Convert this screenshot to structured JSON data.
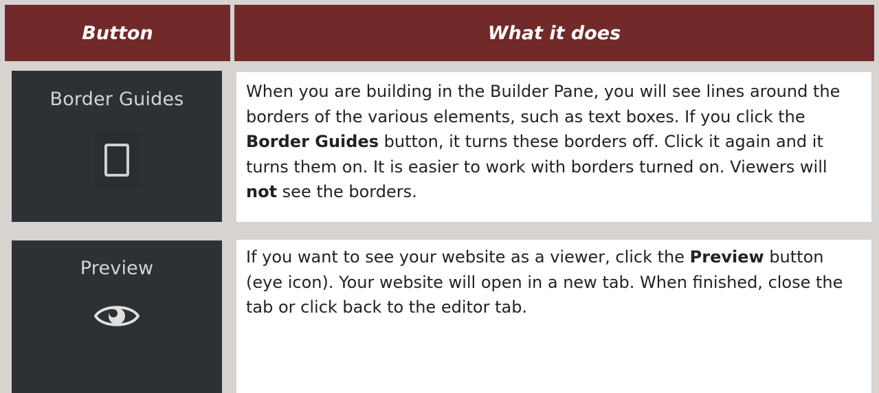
{
  "header": {
    "col_button": "Button",
    "col_what": "What it does"
  },
  "rows": [
    {
      "button_label": "Border Guides",
      "icon": "square-outline-icon",
      "desc_parts": [
        "When you are building in the Builder Pane, you will see lines around the borders of the various elements, such as text boxes. If you click the ",
        "Border Guides",
        " button, it turns these borders off. Click it again and it turns them on. It is easier to work with borders turned on. Viewers will ",
        "not",
        " see the borders."
      ]
    },
    {
      "button_label": "Preview",
      "icon": "eye-icon",
      "desc_parts": [
        "If you want to see your website as a viewer, click the ",
        "Preview",
        " button (eye icon). Your website will open in a new tab. When finished, close the tab or click back to the editor tab."
      ]
    }
  ],
  "colors": {
    "header_bg": "#71292a",
    "header_text": "#ffffff",
    "button_cell_bg": "#2d3134",
    "button_cell_text": "#d4d4d4",
    "border_gray": "#d6d3d1"
  }
}
